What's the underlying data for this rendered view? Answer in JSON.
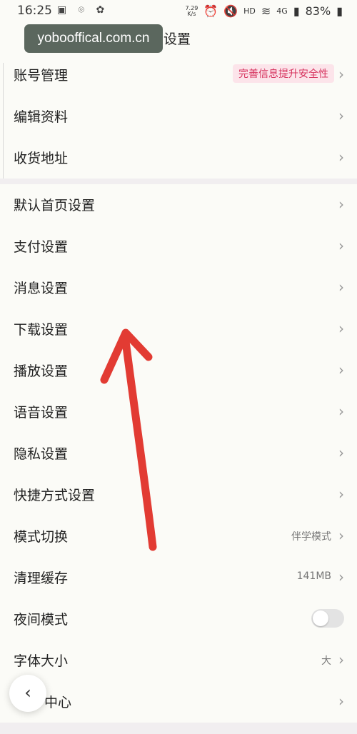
{
  "statusbar": {
    "time": "16:25",
    "left_icons": "▣ ⌾ ✿",
    "speed": "7.29",
    "speed_unit": "K/s",
    "hd": "HD",
    "net": "4G",
    "battery": "83%"
  },
  "header": {
    "title": "设置"
  },
  "watermark": {
    "text": "yobooffical.com.cn"
  },
  "settings": {
    "account": {
      "label": "账号管理",
      "tag": "完善信息提升安全性"
    },
    "edit_profile": {
      "label": "编辑资料"
    },
    "address": {
      "label": "收货地址"
    },
    "default_home": {
      "label": "默认首页设置"
    },
    "payment": {
      "label": "支付设置"
    },
    "message": {
      "label": "消息设置"
    },
    "download": {
      "label": "下载设置"
    },
    "playback": {
      "label": "播放设置"
    },
    "voice": {
      "label": "语音设置"
    },
    "privacy": {
      "label": "隐私设置"
    },
    "shortcut": {
      "label": "快捷方式设置"
    },
    "mode_switch": {
      "label": "模式切换",
      "value": "伴学模式"
    },
    "clear_cache": {
      "label": "清理缓存",
      "value": "141MB"
    },
    "night_mode": {
      "label": "夜间模式",
      "enabled": false
    },
    "font_size": {
      "label": "字体大小",
      "value": "大"
    },
    "help_center": {
      "label": "中心"
    }
  },
  "colors": {
    "tag_bg": "#fce4ea",
    "tag_text": "#d6335e",
    "annotation_arrow": "#e23b33"
  },
  "icons": {
    "chevron": "›",
    "back": "‹"
  }
}
